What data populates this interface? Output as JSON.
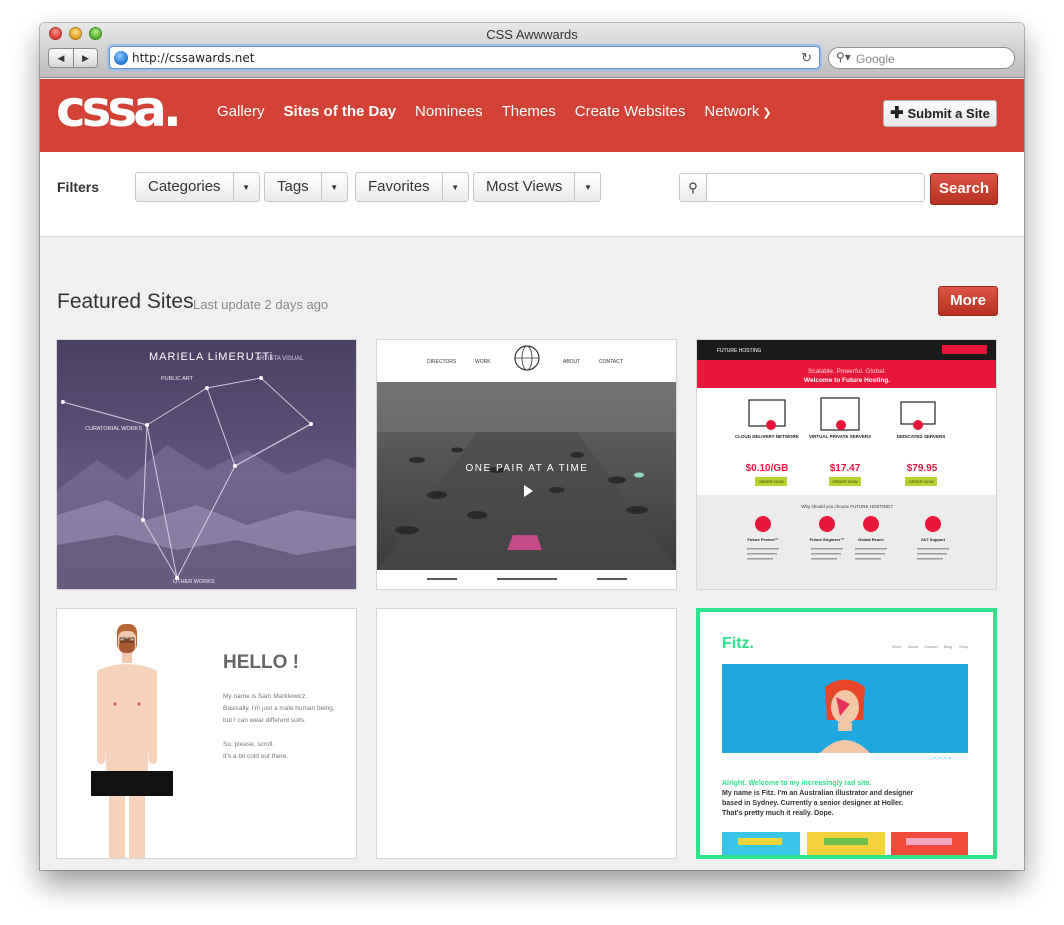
{
  "window": {
    "title": "CSS Awwwards",
    "url": "http://cssawards.net",
    "search_placeholder": "Google"
  },
  "site": {
    "logo": "cssa.",
    "nav": [
      {
        "label": "Gallery"
      },
      {
        "label": "Sites of the Day",
        "active": true
      },
      {
        "label": "Nominees"
      },
      {
        "label": "Themes"
      },
      {
        "label": "Create Websites"
      },
      {
        "label": "Network"
      }
    ],
    "submit_label": "Submit a Site"
  },
  "filters": {
    "label": "Filters",
    "dropdowns": [
      "Categories",
      "Tags",
      "Favorites",
      "Most Views"
    ],
    "search_button": "Search"
  },
  "featured": {
    "title": "Featured Sites",
    "subtitle": "Last update 2 days ago",
    "more_label": "More"
  },
  "cards": {
    "c1": {
      "brand": "MARIELA LiMERUTTi",
      "tagline": "ARTISTA VISUAL",
      "labels": [
        "PUBLIC ART",
        "CURATORIAL WORKS",
        "OTHER WORKS"
      ]
    },
    "c2": {
      "nav": [
        "DIRECTORS",
        "WORK",
        "ABOUT",
        "CONTACT"
      ],
      "headline": "ONE PAIR AT A TIME"
    },
    "c3": {
      "brand": "FUTURE HOSTING",
      "tagline": "Scalable. Powerful. Global.",
      "headline": "Welcome to Future Hosting.",
      "plans": [
        {
          "name": "CLOUD DELIVERY NETWORK",
          "price": "$0.10/GB"
        },
        {
          "name": "VIRTUAL PRIVATE SERVERS",
          "price": "$17.47"
        },
        {
          "name": "DEDICATED SERVERS",
          "price": "$79.95"
        }
      ],
      "cta": "ORDER NOW",
      "why": "Why should you choose FUTURE HOSTING?",
      "features": [
        "Future Protect™",
        "Future Engineer™",
        "Global Reach",
        "24/7 Support"
      ]
    },
    "c4": {
      "hello": "HELLO !",
      "line1": "My name is Sam Marklewicz.",
      "line2": "Basically, I'm just a male human being,",
      "line3": "but I can wear different suits.",
      "line4": "So, please, scroll.",
      "line5": "It's a bit cold out there."
    },
    "c6": {
      "brand": "Fitz.",
      "nav": [
        "Work",
        "About",
        "Contact",
        "Blog",
        "Shop"
      ],
      "green_line": "Alright. Welcome to my increasingly rad site.",
      "body1": "My name is Fitz. I'm an Australian illustrator and designer",
      "body2": "based in Sydney. Currently a senior designer at Holler.",
      "body3": "That's pretty much it really. Dope."
    }
  },
  "colors": {
    "brand_red": "#d24133",
    "fitz_green": "#2ee28c",
    "future_red": "#e8173a",
    "fitz_blue": "#1fa8e0"
  }
}
